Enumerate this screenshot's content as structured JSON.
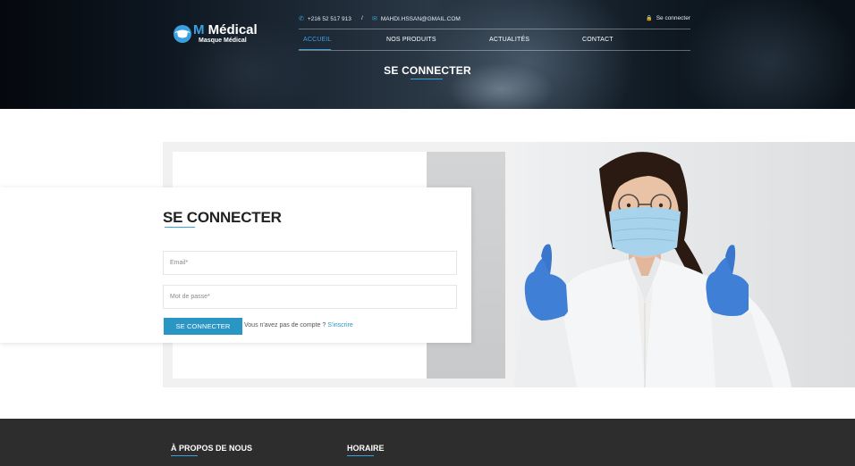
{
  "brand": {
    "name_m": "M",
    "name_rest": "Médical",
    "tagline": "Masque Médical",
    "accent": "#3ba0e0"
  },
  "topbar": {
    "phone_icon": "phone-icon",
    "phone": "+216 52 517 913",
    "separator": "/",
    "email_icon": "mail-icon",
    "email": "MAHDI.HSSAN@GMAIL.COM",
    "login_icon": "lock-icon",
    "login_label": "Se connecter"
  },
  "nav": {
    "items": [
      {
        "label": "ACCUEIL",
        "active": true
      },
      {
        "label": "NOS PRODUITS",
        "active": false
      },
      {
        "label": "ACTUALITÉS",
        "active": false
      },
      {
        "label": "CONTACT",
        "active": false
      }
    ]
  },
  "hero": {
    "title": "SE CONNECTER"
  },
  "login": {
    "title": "SE CONNECTER",
    "email_placeholder": "Email*",
    "password_placeholder": "Mot de passe*",
    "submit_label": "SE CONNECTER",
    "no_account_text": "Vous n'avez pas de compte ?",
    "signup_link": "S'inscrire",
    "button_color": "#2a96c4"
  },
  "footer": {
    "about_heading": "À PROPOS DE NOUS",
    "hours_heading": "HORAIRE",
    "background": "#2d2d2d"
  }
}
